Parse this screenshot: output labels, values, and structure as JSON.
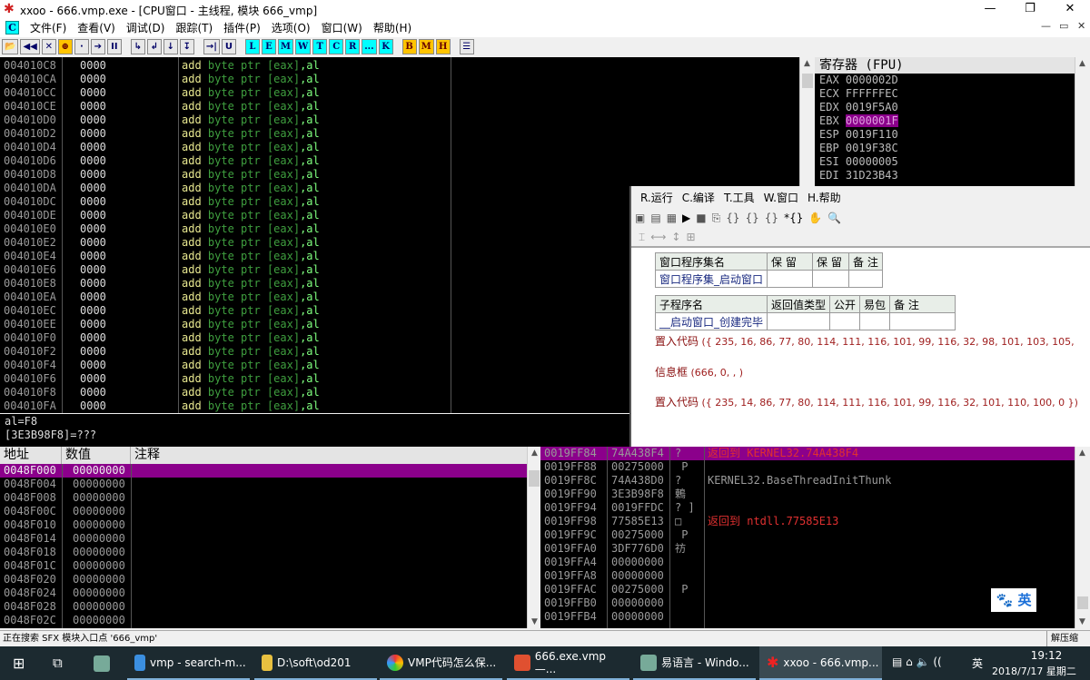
{
  "window": {
    "title": "xxoo - 666.vmp.exe - [CPU窗口 - 主线程, 模块 666_vmp]",
    "min": "—",
    "max": "❐",
    "close": "✕",
    "mdi": [
      "—",
      "▭",
      "✕"
    ]
  },
  "menu": {
    "c_icon": "C",
    "items": [
      "文件(F)",
      "查看(V)",
      "调试(D)",
      "跟踪(T)",
      "插件(P)",
      "选项(O)",
      "窗口(W)",
      "帮助(H)"
    ]
  },
  "toolbar": {
    "buttons": [
      "📂",
      "◀◀",
      "✕",
      "⊕",
      "·",
      "➔",
      "II",
      "↳",
      "↲",
      "↓",
      "↧",
      "→|",
      "U"
    ],
    "letters_cyan": [
      "L",
      "E",
      "M",
      "W",
      "T",
      "C",
      "R",
      "...",
      "K"
    ],
    "letters_yellow": [
      "B",
      "M",
      "H"
    ],
    "list": "☰"
  },
  "disasm": {
    "addresses": [
      "004010C8",
      "004010CA",
      "004010CC",
      "004010CE",
      "004010D0",
      "004010D2",
      "004010D4",
      "004010D6",
      "004010D8",
      "004010DA",
      "004010DC",
      "004010DE",
      "004010E0",
      "004010E2",
      "004010E4",
      "004010E6",
      "004010E8",
      "004010EA",
      "004010EC",
      "004010EE",
      "004010F0",
      "004010F2",
      "004010F4",
      "004010F6",
      "004010F8",
      "004010FA"
    ],
    "hex": "0000",
    "mnemonic": "add",
    "operand1": "byte ptr",
    "operand2": "[eax]",
    "operand3": ",al"
  },
  "info": {
    "line1": "al=F8",
    "line2": "[3E3B98F8]=???"
  },
  "registers": {
    "title": "寄存器 (FPU)",
    "items": [
      {
        "name": "EAX",
        "value": "0000002D"
      },
      {
        "name": "ECX",
        "value": "FFFFFFEC"
      },
      {
        "name": "EDX",
        "value": "0019F5A0"
      },
      {
        "name": "EBX",
        "value": "0000001F",
        "highlight": true
      },
      {
        "name": "ESP",
        "value": "0019F110"
      },
      {
        "name": "EBP",
        "value": "0019F38C"
      },
      {
        "name": "ESI",
        "value": "00000005"
      },
      {
        "name": "EDI",
        "value": "31D23B43"
      }
    ]
  },
  "dump": {
    "headers": [
      "地址",
      "数值",
      "注释"
    ],
    "rows": [
      [
        "0048F000",
        "00000000"
      ],
      [
        "0048F004",
        "00000000"
      ],
      [
        "0048F008",
        "00000000"
      ],
      [
        "0048F00C",
        "00000000"
      ],
      [
        "0048F010",
        "00000000"
      ],
      [
        "0048F014",
        "00000000"
      ],
      [
        "0048F018",
        "00000000"
      ],
      [
        "0048F01C",
        "00000000"
      ],
      [
        "0048F020",
        "00000000"
      ],
      [
        "0048F024",
        "00000000"
      ],
      [
        "0048F028",
        "00000000"
      ],
      [
        "0048F02C",
        "00000000"
      ]
    ]
  },
  "stack": {
    "rows": [
      [
        "0019FF84",
        "74A438F4",
        "?",
        "返回到 KERNEL32.74A438F4"
      ],
      [
        "0019FF88",
        "00275000",
        " P",
        ""
      ],
      [
        "0019FF8C",
        "74A438D0",
        "?",
        "KERNEL32.BaseThreadInitThunk"
      ],
      [
        "0019FF90",
        "3E3B98F8",
        "鶇",
        ""
      ],
      [
        "0019FF94",
        "0019FFDC",
        "? ]",
        ""
      ],
      [
        "0019FF98",
        "77585E13",
        "□",
        "返回到 ntdll.77585E13"
      ],
      [
        "0019FF9C",
        "00275000",
        " P",
        ""
      ],
      [
        "0019FFA0",
        "3DF776D0",
        "祊",
        ""
      ],
      [
        "0019FFA4",
        "00000000",
        "",
        ""
      ],
      [
        "0019FFA8",
        "00000000",
        "",
        ""
      ],
      [
        "0019FFAC",
        "00275000",
        " P",
        ""
      ],
      [
        "0019FFB0",
        "00000000",
        "",
        ""
      ],
      [
        "0019FFB4",
        "00000000",
        "",
        ""
      ]
    ]
  },
  "ime": {
    "paw": "🐾",
    "lang": "英"
  },
  "eyuyan": {
    "menu": [
      "R.运行",
      "C.编译",
      "T.工具",
      "W.窗口",
      "H.帮助"
    ],
    "table1": {
      "headers": [
        "窗口程序集名",
        "保 留",
        "保 留",
        "备 注"
      ],
      "row": [
        "窗口程序集_启动窗口",
        "",
        "",
        ""
      ]
    },
    "table2": {
      "headers": [
        "子程序名",
        "返回值类型",
        "公开",
        "易包",
        "备 注"
      ],
      "row": [
        "__启动窗口_创建完毕",
        "",
        "",
        "",
        ""
      ]
    },
    "code": [
      {
        "kw": "置入代码",
        "args": " ({ 235, 16, 86, 77, 80, 114, 111, 116, 101, 99, 116, 32, 98, 101, 103, 105,"
      },
      {
        "kw": "信息框",
        "args": " (666, 0, , )"
      },
      {
        "kw": "置入代码",
        "args": " ({ 235, 14, 86, 77, 80, 114, 111, 116, 101, 99, 116, 32, 101, 110, 100, 0 })"
      }
    ]
  },
  "status": {
    "text": "正在搜索 SFX 模块入口点 '666_vmp'",
    "right": "解压缩"
  },
  "taskbar": {
    "tasks": [
      "vmp - search-m...",
      "D:\\soft\\od201",
      "VMP代码怎么保...",
      "666.exe.vmp —...",
      "易语言 - Windo...",
      "xxoo - 666.vmp..."
    ],
    "time": "19:12",
    "date": "2018/7/17 星期二",
    "ime": "英"
  }
}
